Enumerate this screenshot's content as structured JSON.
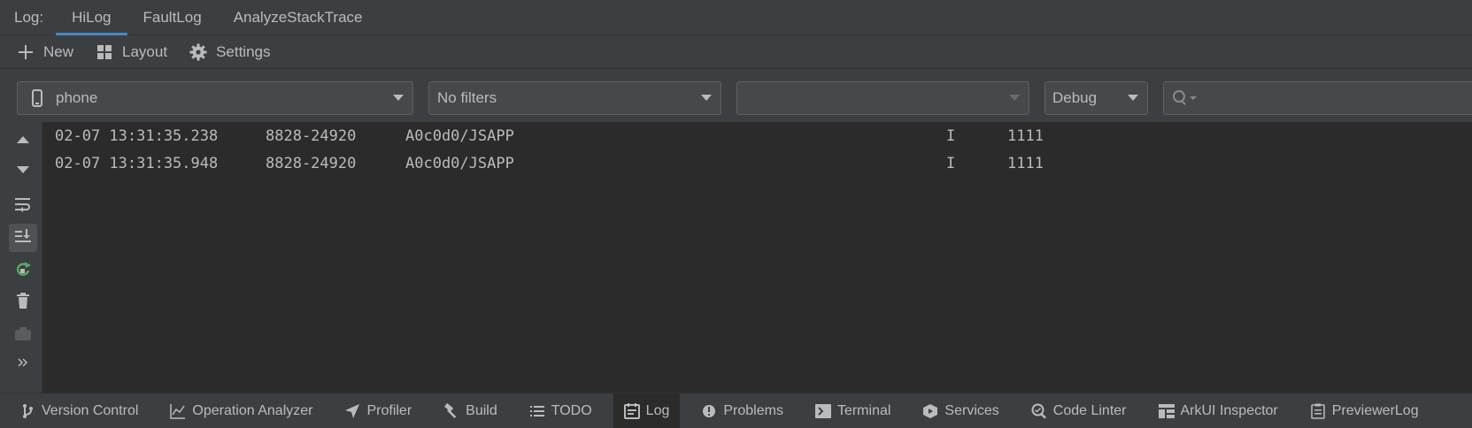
{
  "tabbar": {
    "prefix": "Log:",
    "tabs": [
      {
        "label": "HiLog",
        "active": true
      },
      {
        "label": "FaultLog",
        "active": false
      },
      {
        "label": "AnalyzeStackTrace",
        "active": false
      }
    ]
  },
  "toolbar": {
    "new_label": "New",
    "layout_label": "Layout",
    "settings_label": "Settings"
  },
  "filters": {
    "device": "phone",
    "process_filter": "No filters",
    "third_filter": "",
    "level": "Debug",
    "search_value": ""
  },
  "log": {
    "rows": [
      {
        "time": "02-07 13:31:35.238",
        "pid": "8828-24920",
        "tag": "A0c0d0/JSAPP",
        "level": "I",
        "message": "1111"
      },
      {
        "time": "02-07 13:31:35.948",
        "pid": "8828-24920",
        "tag": "A0c0d0/JSAPP",
        "level": "I",
        "message": "1111"
      }
    ]
  },
  "bottombar": {
    "items": [
      {
        "label": "Version Control",
        "icon": "branch-icon"
      },
      {
        "label": "Operation Analyzer",
        "icon": "chart-icon"
      },
      {
        "label": "Profiler",
        "icon": "profiler-icon"
      },
      {
        "label": "Build",
        "icon": "hammer-icon"
      },
      {
        "label": "TODO",
        "icon": "list-icon"
      },
      {
        "label": "Log",
        "icon": "log-icon",
        "active": true
      },
      {
        "label": "Problems",
        "icon": "warning-icon"
      },
      {
        "label": "Terminal",
        "icon": "terminal-icon"
      },
      {
        "label": "Services",
        "icon": "services-icon"
      },
      {
        "label": "Code Linter",
        "icon": "linter-icon"
      },
      {
        "label": "ArkUI Inspector",
        "icon": "inspector-icon"
      },
      {
        "label": "PreviewerLog",
        "icon": "previewer-log-icon"
      }
    ]
  },
  "colors": {
    "panel": "#3c3f41",
    "editor": "#2b2b2b",
    "accent": "#4a88c7",
    "text": "#bbbbbb"
  }
}
